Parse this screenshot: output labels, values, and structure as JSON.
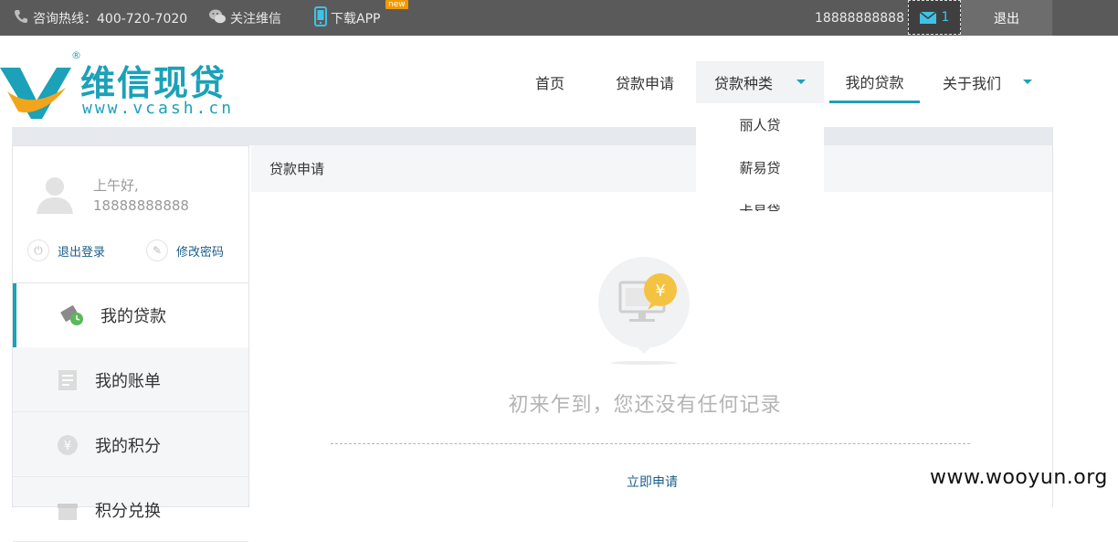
{
  "topbar": {
    "hotline": "咨询热线：400-720-7020",
    "wechat": "关注维信",
    "app": "下载APP",
    "app_badge": "new",
    "phone": "18888888888",
    "message_count": "1",
    "logout": "退出"
  },
  "logo": {
    "brand": "维信现贷",
    "site": "www.vcash.cn",
    "reg": "®"
  },
  "nav": {
    "home": "首页",
    "apply": "贷款申请",
    "types": "贷款种类",
    "my_loan": "我的贷款",
    "about": "关于我们"
  },
  "dropdown": {
    "items": [
      "丽人贷",
      "薪易贷",
      "卡易贷"
    ]
  },
  "sidebar": {
    "greeting": "上午好,",
    "phone": "18888888888",
    "logout": "退出登录",
    "change_password": "修改密码",
    "menu": [
      "我的贷款",
      "我的账单",
      "我的积分",
      "积分兑换"
    ]
  },
  "main": {
    "title": "贷款申请",
    "empty_text": "初来乍到，您还没有任何记录",
    "apply_now": "立即申请"
  },
  "watermark": "www.wooyun.org",
  "colors": {
    "accent": "#1ba1b8",
    "topbar": "#5a5a5a",
    "link": "#1b5e8a"
  }
}
